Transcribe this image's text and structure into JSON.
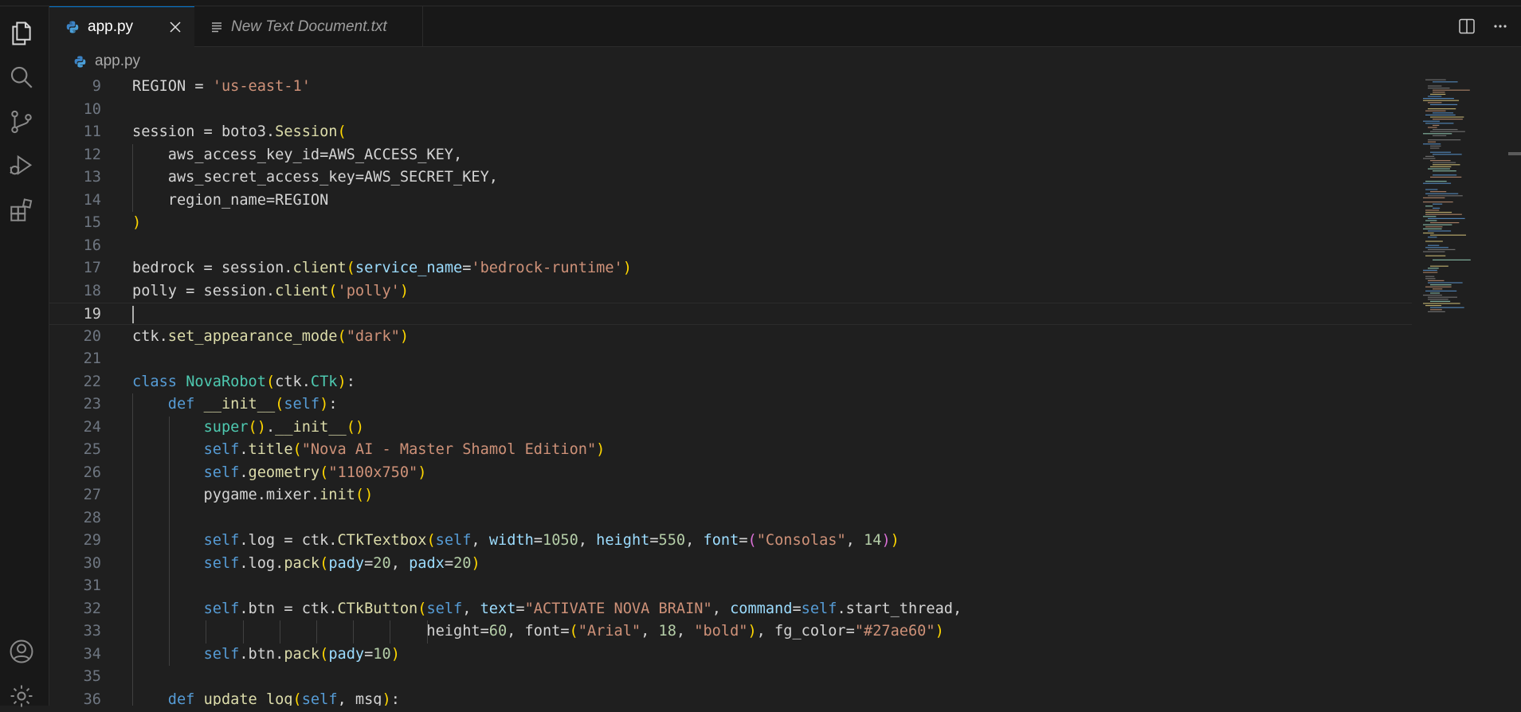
{
  "tabs": [
    {
      "label": "app.py",
      "active": true,
      "icon": "python-icon"
    },
    {
      "label": "New Text Document.txt",
      "active": false,
      "icon": "text-file-icon"
    }
  ],
  "breadcrumb": {
    "file": "app.py",
    "icon": "python-icon"
  },
  "editor": {
    "current_line": 19,
    "lines": [
      {
        "n": "9",
        "text": "REGION = 'us-east-1'"
      },
      {
        "n": "10",
        "text": ""
      },
      {
        "n": "11",
        "text": "session = boto3.Session("
      },
      {
        "n": "12",
        "text": "    aws_access_key_id=AWS_ACCESS_KEY,"
      },
      {
        "n": "13",
        "text": "    aws_secret_access_key=AWS_SECRET_KEY,"
      },
      {
        "n": "14",
        "text": "    region_name=REGION"
      },
      {
        "n": "15",
        "text": ")"
      },
      {
        "n": "16",
        "text": ""
      },
      {
        "n": "17",
        "text": "bedrock = session.client(service_name='bedrock-runtime')"
      },
      {
        "n": "18",
        "text": "polly = session.client('polly')"
      },
      {
        "n": "19",
        "text": ""
      },
      {
        "n": "20",
        "text": "ctk.set_appearance_mode(\"dark\")"
      },
      {
        "n": "21",
        "text": ""
      },
      {
        "n": "22",
        "text": "class NovaRobot(ctk.CTk):"
      },
      {
        "n": "23",
        "text": "    def __init__(self):"
      },
      {
        "n": "24",
        "text": "        super().__init__()"
      },
      {
        "n": "25",
        "text": "        self.title(\"Nova AI - Master Shamol Edition\")"
      },
      {
        "n": "26",
        "text": "        self.geometry(\"1100x750\")"
      },
      {
        "n": "27",
        "text": "        pygame.mixer.init()"
      },
      {
        "n": "28",
        "text": ""
      },
      {
        "n": "29",
        "text": "        self.log = ctk.CTkTextbox(self, width=1050, height=550, font=(\"Consolas\", 14))"
      },
      {
        "n": "30",
        "text": "        self.log.pack(pady=20, padx=20)"
      },
      {
        "n": "31",
        "text": ""
      },
      {
        "n": "32",
        "text": "        self.btn = ctk.CTkButton(self, text=\"ACTIVATE NOVA BRAIN\", command=self.start_thread,"
      },
      {
        "n": "33",
        "text": "                                 height=60, font=(\"Arial\", 18, \"bold\"), fg_color=\"#27ae60\")"
      },
      {
        "n": "34",
        "text": "        self.btn.pack(pady=10)"
      },
      {
        "n": "35",
        "text": ""
      },
      {
        "n": "36",
        "text": "    def update_log(self, msg):"
      }
    ]
  },
  "activity_bar": [
    "explorer-icon",
    "search-icon",
    "source-control-icon",
    "run-debug-icon",
    "extensions-icon",
    "account-icon",
    "settings-icon"
  ],
  "colors": {
    "accent": "#0078d4",
    "python": "#3572A5",
    "editor_bg": "#1f1f1f"
  }
}
